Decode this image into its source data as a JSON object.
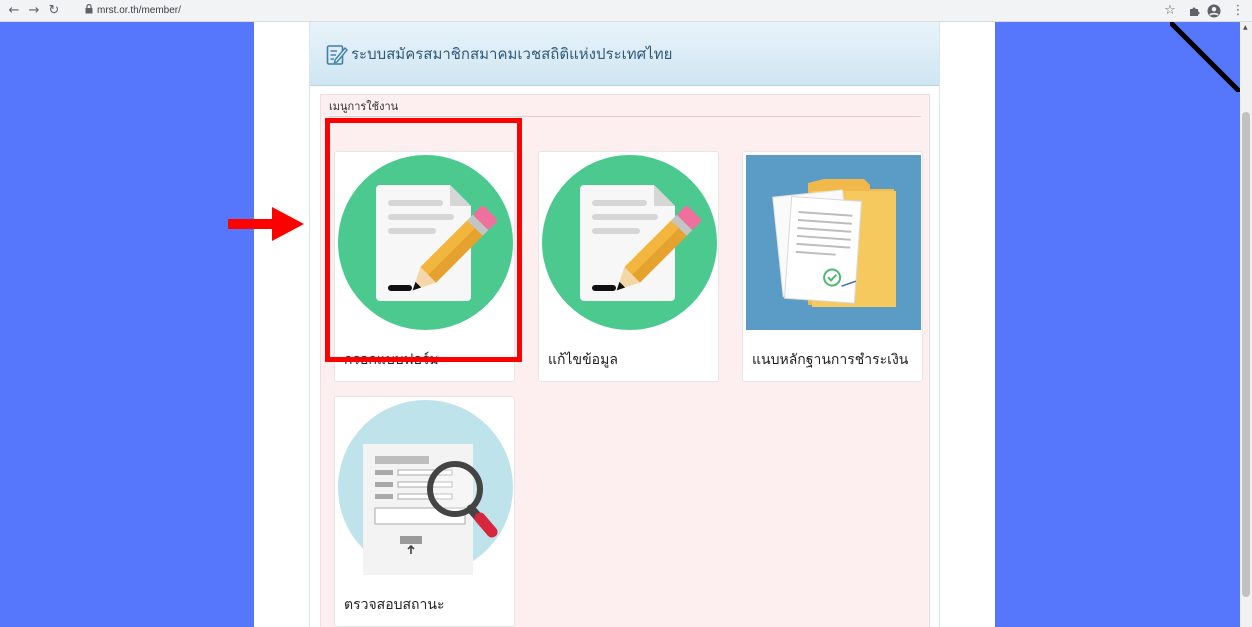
{
  "browser": {
    "back_icon": "arrow-left-icon",
    "forward_icon": "arrow-right-icon",
    "reload_icon": "reload-icon",
    "lock_icon": "lock-icon",
    "url": "mrst.or.th/member/",
    "bookmark_icon": "star-icon",
    "extensions_icon": "puzzle-icon",
    "profile_icon": "account-icon",
    "menu_icon": "kebab-menu-icon"
  },
  "header": {
    "icon": "edit-form-icon",
    "title": "ระบบสมัครสมาชิกสมาคมเวชสถิติแห่งประเทศไทย"
  },
  "menu": {
    "label": "เมนูการใช้งาน",
    "items": [
      {
        "label": "กรอกแบบฟอร์ม",
        "icon": "form-pencil-icon",
        "selected": true
      },
      {
        "label": "แก้ไขข้อมูล",
        "icon": "form-pencil-icon",
        "selected": false
      },
      {
        "label": "แนบหลักฐานการชำระเงิน",
        "icon": "document-envelope-icon",
        "selected": false
      },
      {
        "label": "ตรวจสอบสถานะ",
        "icon": "document-search-icon",
        "selected": false
      }
    ]
  },
  "annotation": {
    "arrow_icon": "red-arrow-icon",
    "highlight_color": "#ff0000"
  },
  "colors": {
    "side_background": "#5677fc",
    "menu_background": "#fdeef0",
    "green_circle": "#4cc98f",
    "blue_tile": "#5b9cc6",
    "light_circle": "#bfe3ea"
  }
}
